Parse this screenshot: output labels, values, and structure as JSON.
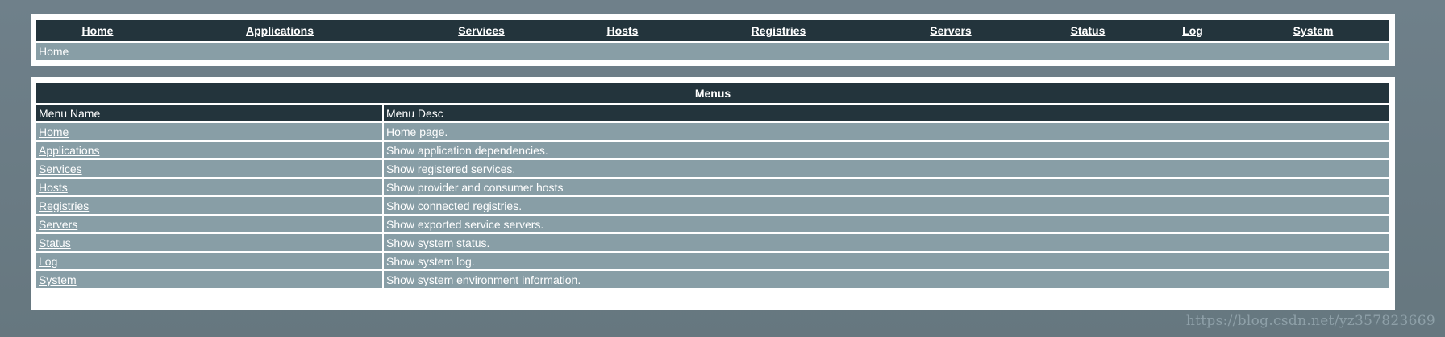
{
  "nav": {
    "items": [
      {
        "label": "Home"
      },
      {
        "label": "Applications"
      },
      {
        "label": "Services"
      },
      {
        "label": "Hosts"
      },
      {
        "label": "Registries"
      },
      {
        "label": "Servers"
      },
      {
        "label": "Status"
      },
      {
        "label": "Log"
      },
      {
        "label": "System"
      }
    ],
    "breadcrumb": "Home"
  },
  "menus": {
    "title": "Menus",
    "headers": {
      "name": "Menu Name",
      "desc": "Menu Desc"
    },
    "rows": [
      {
        "name": "Home",
        "desc": "Home page."
      },
      {
        "name": "Applications",
        "desc": "Show application dependencies."
      },
      {
        "name": "Services",
        "desc": "Show registered services."
      },
      {
        "name": "Hosts",
        "desc": "Show provider and consumer hosts"
      },
      {
        "name": "Registries",
        "desc": "Show connected registries."
      },
      {
        "name": "Servers",
        "desc": "Show exported service servers."
      },
      {
        "name": "Status",
        "desc": "Show system status."
      },
      {
        "name": "Log",
        "desc": "Show system log."
      },
      {
        "name": "System",
        "desc": "Show system environment information."
      }
    ]
  },
  "watermark": "https://blog.csdn.net/yz357823669",
  "colors": {
    "background": "#6b7c85",
    "header_dark": "#23343c",
    "row_light": "#889ea6",
    "text": "#ffffff"
  }
}
